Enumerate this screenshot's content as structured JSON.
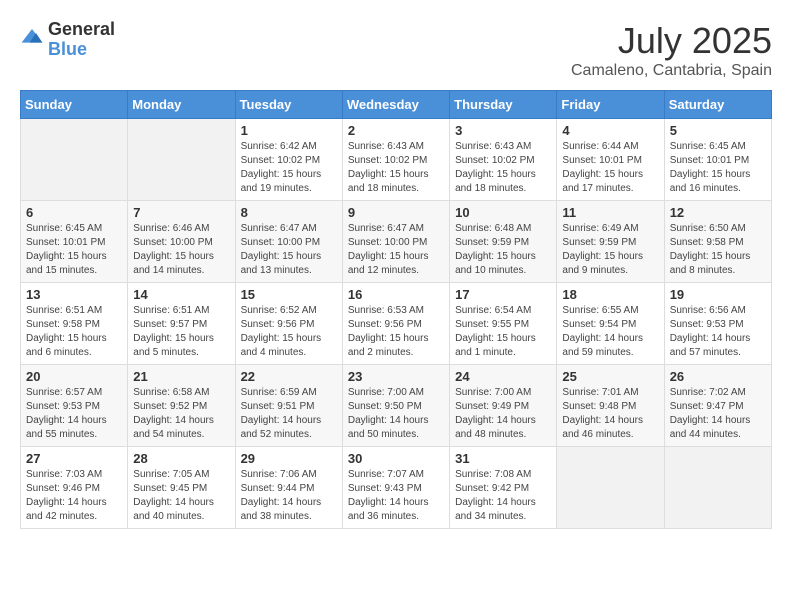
{
  "header": {
    "logo_general": "General",
    "logo_blue": "Blue",
    "month": "July 2025",
    "location": "Camaleno, Cantabria, Spain"
  },
  "days_of_week": [
    "Sunday",
    "Monday",
    "Tuesday",
    "Wednesday",
    "Thursday",
    "Friday",
    "Saturday"
  ],
  "weeks": [
    [
      {
        "day": null
      },
      {
        "day": null
      },
      {
        "day": "1",
        "sunrise": "6:42 AM",
        "sunset": "10:02 PM",
        "daylight": "15 hours and 19 minutes."
      },
      {
        "day": "2",
        "sunrise": "6:43 AM",
        "sunset": "10:02 PM",
        "daylight": "15 hours and 18 minutes."
      },
      {
        "day": "3",
        "sunrise": "6:43 AM",
        "sunset": "10:02 PM",
        "daylight": "15 hours and 18 minutes."
      },
      {
        "day": "4",
        "sunrise": "6:44 AM",
        "sunset": "10:01 PM",
        "daylight": "15 hours and 17 minutes."
      },
      {
        "day": "5",
        "sunrise": "6:45 AM",
        "sunset": "10:01 PM",
        "daylight": "15 hours and 16 minutes."
      }
    ],
    [
      {
        "day": "6",
        "sunrise": "6:45 AM",
        "sunset": "10:01 PM",
        "daylight": "15 hours and 15 minutes."
      },
      {
        "day": "7",
        "sunrise": "6:46 AM",
        "sunset": "10:00 PM",
        "daylight": "15 hours and 14 minutes."
      },
      {
        "day": "8",
        "sunrise": "6:47 AM",
        "sunset": "10:00 PM",
        "daylight": "15 hours and 13 minutes."
      },
      {
        "day": "9",
        "sunrise": "6:47 AM",
        "sunset": "10:00 PM",
        "daylight": "15 hours and 12 minutes."
      },
      {
        "day": "10",
        "sunrise": "6:48 AM",
        "sunset": "9:59 PM",
        "daylight": "15 hours and 10 minutes."
      },
      {
        "day": "11",
        "sunrise": "6:49 AM",
        "sunset": "9:59 PM",
        "daylight": "15 hours and 9 minutes."
      },
      {
        "day": "12",
        "sunrise": "6:50 AM",
        "sunset": "9:58 PM",
        "daylight": "15 hours and 8 minutes."
      }
    ],
    [
      {
        "day": "13",
        "sunrise": "6:51 AM",
        "sunset": "9:58 PM",
        "daylight": "15 hours and 6 minutes."
      },
      {
        "day": "14",
        "sunrise": "6:51 AM",
        "sunset": "9:57 PM",
        "daylight": "15 hours and 5 minutes."
      },
      {
        "day": "15",
        "sunrise": "6:52 AM",
        "sunset": "9:56 PM",
        "daylight": "15 hours and 4 minutes."
      },
      {
        "day": "16",
        "sunrise": "6:53 AM",
        "sunset": "9:56 PM",
        "daylight": "15 hours and 2 minutes."
      },
      {
        "day": "17",
        "sunrise": "6:54 AM",
        "sunset": "9:55 PM",
        "daylight": "15 hours and 1 minute."
      },
      {
        "day": "18",
        "sunrise": "6:55 AM",
        "sunset": "9:54 PM",
        "daylight": "14 hours and 59 minutes."
      },
      {
        "day": "19",
        "sunrise": "6:56 AM",
        "sunset": "9:53 PM",
        "daylight": "14 hours and 57 minutes."
      }
    ],
    [
      {
        "day": "20",
        "sunrise": "6:57 AM",
        "sunset": "9:53 PM",
        "daylight": "14 hours and 55 minutes."
      },
      {
        "day": "21",
        "sunrise": "6:58 AM",
        "sunset": "9:52 PM",
        "daylight": "14 hours and 54 minutes."
      },
      {
        "day": "22",
        "sunrise": "6:59 AM",
        "sunset": "9:51 PM",
        "daylight": "14 hours and 52 minutes."
      },
      {
        "day": "23",
        "sunrise": "7:00 AM",
        "sunset": "9:50 PM",
        "daylight": "14 hours and 50 minutes."
      },
      {
        "day": "24",
        "sunrise": "7:00 AM",
        "sunset": "9:49 PM",
        "daylight": "14 hours and 48 minutes."
      },
      {
        "day": "25",
        "sunrise": "7:01 AM",
        "sunset": "9:48 PM",
        "daylight": "14 hours and 46 minutes."
      },
      {
        "day": "26",
        "sunrise": "7:02 AM",
        "sunset": "9:47 PM",
        "daylight": "14 hours and 44 minutes."
      }
    ],
    [
      {
        "day": "27",
        "sunrise": "7:03 AM",
        "sunset": "9:46 PM",
        "daylight": "14 hours and 42 minutes."
      },
      {
        "day": "28",
        "sunrise": "7:05 AM",
        "sunset": "9:45 PM",
        "daylight": "14 hours and 40 minutes."
      },
      {
        "day": "29",
        "sunrise": "7:06 AM",
        "sunset": "9:44 PM",
        "daylight": "14 hours and 38 minutes."
      },
      {
        "day": "30",
        "sunrise": "7:07 AM",
        "sunset": "9:43 PM",
        "daylight": "14 hours and 36 minutes."
      },
      {
        "day": "31",
        "sunrise": "7:08 AM",
        "sunset": "9:42 PM",
        "daylight": "14 hours and 34 minutes."
      },
      {
        "day": null
      },
      {
        "day": null
      }
    ]
  ],
  "labels": {
    "sunrise": "Sunrise:",
    "sunset": "Sunset:",
    "daylight": "Daylight:"
  }
}
